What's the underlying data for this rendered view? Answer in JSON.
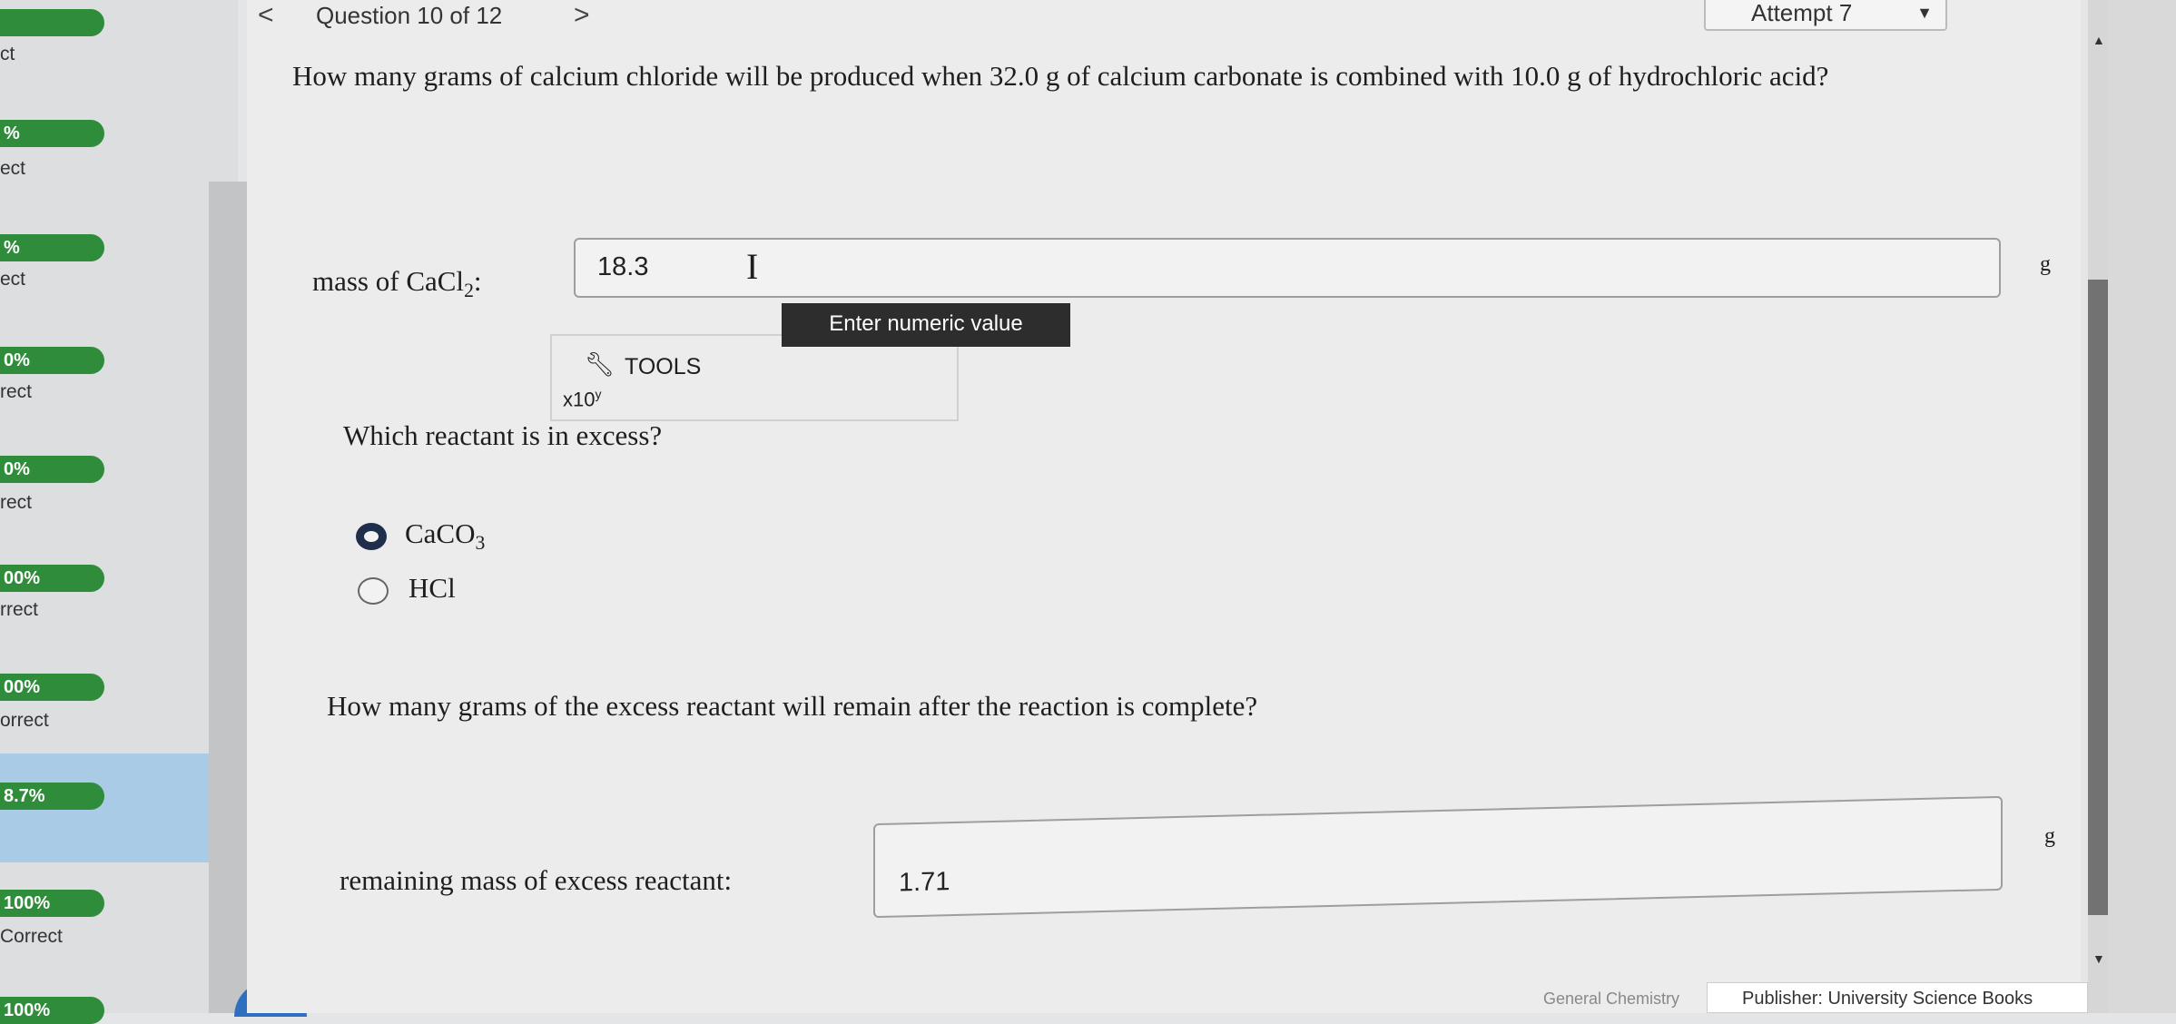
{
  "topbar": {
    "prev_arrow": "<",
    "question_counter": "Question 10 of 12",
    "next_arrow": ">",
    "attempt": "Attempt 7"
  },
  "sidebar": {
    "items": [
      {
        "score": "",
        "status": "ct"
      },
      {
        "score": "%",
        "status": "ect"
      },
      {
        "score": "%",
        "status": "ect"
      },
      {
        "score": "0%",
        "status": "rect"
      },
      {
        "score": "0%",
        "status": "rect"
      },
      {
        "score": "00%",
        "status": "rrect"
      },
      {
        "score": "00%",
        "status": "orrect"
      },
      {
        "score": "8.7%",
        "status": ""
      },
      {
        "score": "100%",
        "status": "Correct"
      },
      {
        "score": "100%",
        "status": ""
      }
    ]
  },
  "question": {
    "text": "How many grams of calcium chloride will be produced when 32.0 g of calcium carbonate is combined with 10.0 g of hydrochloric acid?"
  },
  "part1": {
    "label": "mass of CaCl",
    "label_sub": "2",
    "label_suffix": ":",
    "value": "18.3",
    "unit": "g",
    "tooltip": "Enter numeric value",
    "tools_label": "TOOLS",
    "x10_label": "x10",
    "x10_sup": "y"
  },
  "part2": {
    "question": "Which reactant is in excess?",
    "options": [
      {
        "label": "CaCO",
        "sub": "3",
        "selected": true
      },
      {
        "label": "HCl",
        "sub": "",
        "selected": false
      }
    ]
  },
  "part3": {
    "question": "How many grams of the excess reactant will remain after the reaction is complete?",
    "label": "remaining mass of excess reactant:",
    "value": "1.71",
    "unit": "g"
  },
  "footer": {
    "left": "General Chemistry",
    "publisher": "Publisher: University Science Books"
  }
}
